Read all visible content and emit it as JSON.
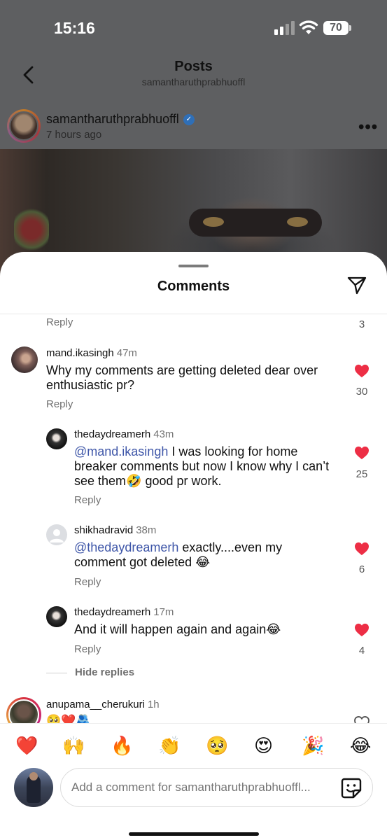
{
  "status_bar": {
    "time": "15:16",
    "battery": "70"
  },
  "nav": {
    "title": "Posts",
    "subtitle": "samantharuthprabhuoffl"
  },
  "post": {
    "username": "samantharuthprabhuoffl",
    "time": "7 hours ago",
    "more": "•••"
  },
  "sheet": {
    "title": "Comments"
  },
  "prev_comment": {
    "reply_label": "Reply",
    "like_count": "3"
  },
  "comments": [
    {
      "username": "mand.ikasingh",
      "time": "47m",
      "text_line1": "Why my comments are getting deleted dear over",
      "text_line2": "enthusiastic pr?",
      "reply_label": "Reply",
      "like_count": "30"
    }
  ],
  "replies": [
    {
      "username": "thedaydreamerh",
      "time": "43m",
      "mention": "@mand.ikasingh",
      "text_line1": " I was looking for home",
      "text_line2": "breaker comments but now I know why I can’t",
      "text_line3": "see them🤣 good pr work.",
      "reply_label": "Reply",
      "like_count": "25"
    },
    {
      "username": "shikhadravid",
      "time": "38m",
      "mention": "@thedaydreamerh",
      "text_line1": " exactly....even my",
      "text_line2": "comment got deleted 😂",
      "reply_label": "Reply",
      "like_count": "6"
    },
    {
      "username": "thedaydreamerh",
      "time": "17m",
      "text_line1": "And it will happen again and again😂",
      "reply_label": "Reply",
      "like_count": "4"
    }
  ],
  "hide_replies": "Hide replies",
  "last_comment": {
    "username": "anupama__cherukuri",
    "time": "1h",
    "text": "🥺❤️🫂"
  },
  "emoji_bar": [
    "❤️",
    "🙌",
    "🔥",
    "👏",
    "🥺",
    "😍",
    "🎉",
    "😂"
  ],
  "composer": {
    "placeholder": "Add a comment for samantharuthprabhuoffl..."
  },
  "colors": {
    "heart": "#ed2e45",
    "mention": "#3e56a8",
    "meta": "#707070"
  }
}
